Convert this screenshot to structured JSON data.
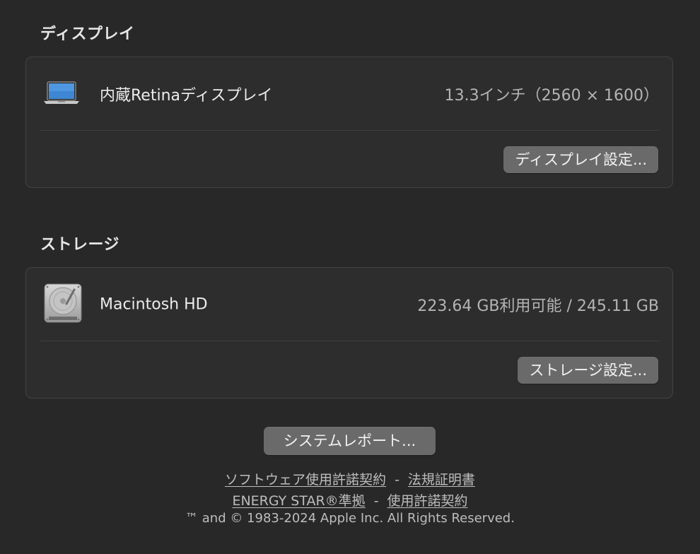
{
  "display_section": {
    "title": "ディスプレイ",
    "item": {
      "icon": "laptop-icon",
      "label": "内蔵Retinaディスプレイ",
      "value": "13.3インチ（2560 × 1600）"
    },
    "button_label": "ディスプレイ設定..."
  },
  "storage_section": {
    "title": "ストレージ",
    "item": {
      "icon": "hard-drive-icon",
      "label": "Macintosh HD",
      "value": "223.64 GB利用可能 / 245.11 GB"
    },
    "button_label": "ストレージ設定..."
  },
  "system_report_label": "システムレポート...",
  "footer": {
    "line1": {
      "link1": "ソフトウェア使用許諾契約",
      "separator": "-",
      "link2": "法規証明書"
    },
    "line2": {
      "link1": "ENERGY STAR®準拠",
      "separator": "-",
      "link2": "使用許諾契約"
    },
    "copyright": "™ and © 1983-2024 Apple Inc. All Rights Reserved."
  },
  "colors": {
    "background": "#282828",
    "card": "#2d2d2d",
    "button": "#6a6a6a"
  }
}
